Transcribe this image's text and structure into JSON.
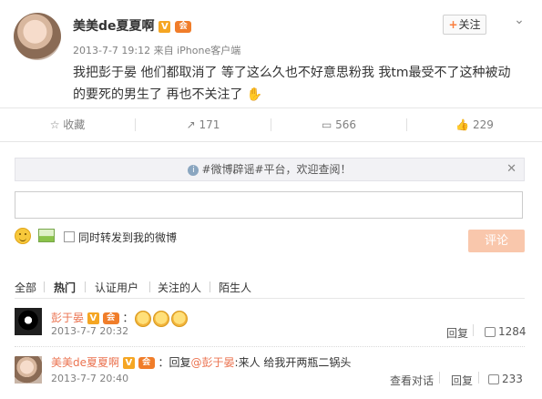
{
  "post": {
    "author_name": "美美de夏夏啊",
    "verified_badge": "V",
    "vip_badge": "会",
    "meta": "2013-7-7 19:12 来自 iPhone客户端",
    "follow_label": "关注",
    "follow_plus": "+",
    "more_glyph": "⌄",
    "content": "我把彭于晏 他们都取消了 等了这么久也不好意思粉我 我tm最受不了这种被动的要死的男生了 再也不关注了",
    "hand_glyph": "✋"
  },
  "actions": {
    "favorite_label": "收藏",
    "repost_count": "171",
    "comment_count": "566",
    "like_count": "229",
    "favorite_icon": "☆",
    "repost_icon": "↗",
    "comment_icon": "▭",
    "like_icon": "👍"
  },
  "notice": {
    "text": "#微博辟谣#平台，欢迎查阅！",
    "close_glyph": "✕",
    "icon_glyph": "i"
  },
  "composer": {
    "input_value": "",
    "repost_checkbox_label": "同时转发到我的微博",
    "submit_label": "评论"
  },
  "filters": {
    "tabs": [
      "全部",
      "热门",
      "认证用户",
      "关注的人",
      "陌生人"
    ]
  },
  "comments": [
    {
      "name": "彭于晏",
      "verified_badge": "V",
      "vip_badge": "会",
      "text": "：",
      "time": "2013-7-7 20:32",
      "reply_label": "回复",
      "like_count": "1284"
    },
    {
      "name": "美美de夏夏啊",
      "verified_badge": "V",
      "vip_badge": "会",
      "text": "：回复",
      "mention": "@彭于晏",
      "text_after": ":来人 给我开两瓶二锅头",
      "time": "2013-7-7 20:40",
      "view_dialog_label": "查看对话",
      "reply_label": "回复",
      "like_count": "233"
    }
  ],
  "colors": {
    "orange_link": "#eb7350",
    "submit_disabled": "#f9c7ac",
    "badge_v": "#f5a623"
  }
}
